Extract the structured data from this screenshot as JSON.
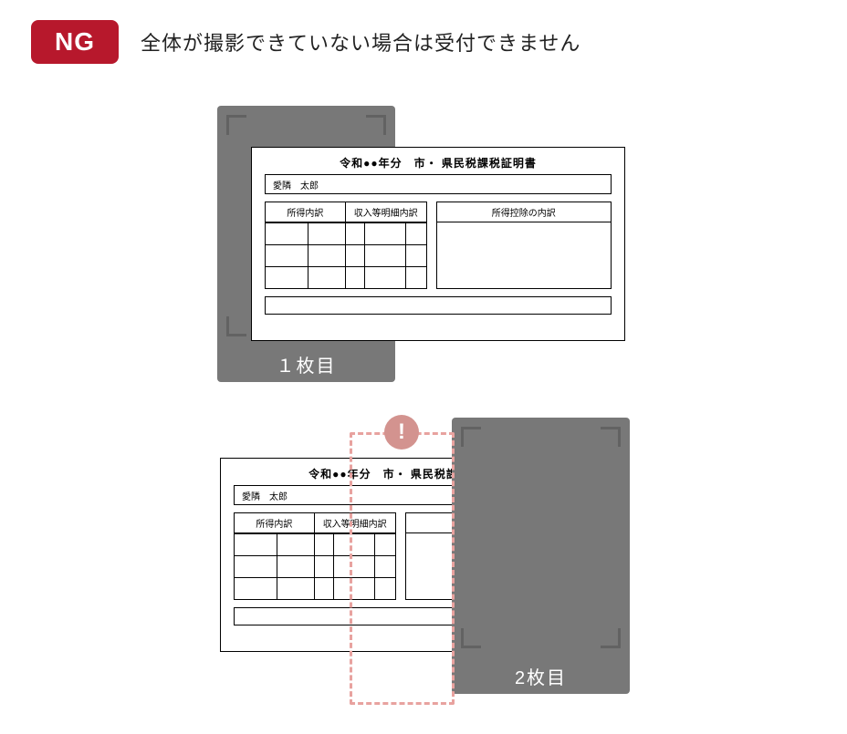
{
  "header": {
    "badge": "NG",
    "title": "全体が撮影できていない場合は受付できません"
  },
  "phone1": {
    "label": "１枚目"
  },
  "phone2": {
    "label": "2枚目"
  },
  "doc": {
    "title": "令和●●年分　市・ 県民税課税証明書",
    "name": "愛隣　太郎",
    "col1": "所得内訳",
    "col2": "収入等明細内訳",
    "col3": "所得控除の内訳"
  },
  "warn": "!"
}
